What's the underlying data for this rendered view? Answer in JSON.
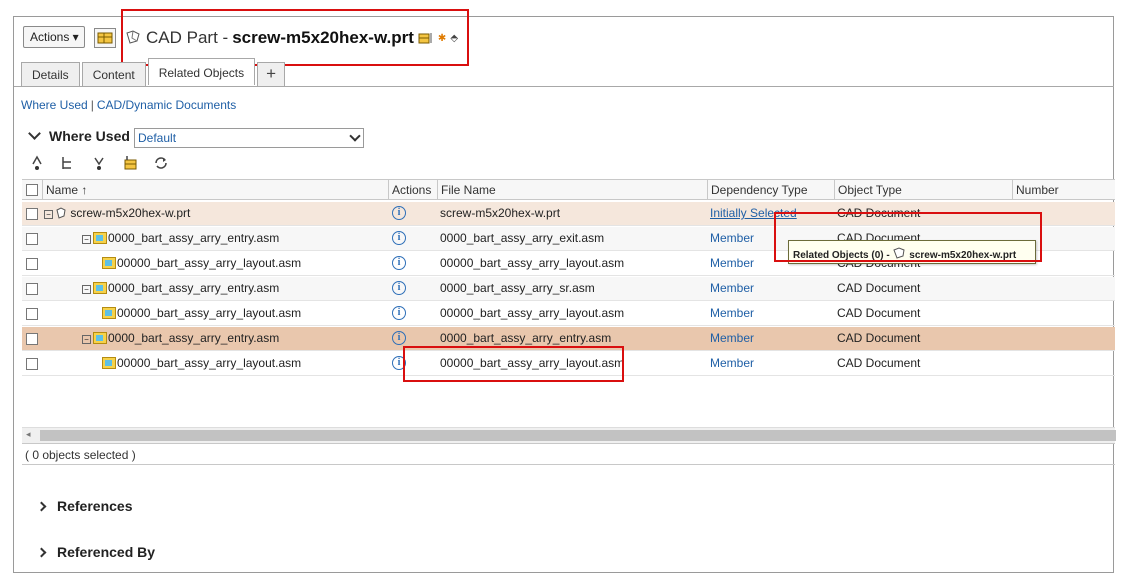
{
  "header": {
    "actions_label": "Actions ▾",
    "object_type": "CAD Part -",
    "object_name": "screw-m5x20hex-w.prt"
  },
  "tabs": [
    {
      "label": "Details"
    },
    {
      "label": "Content"
    },
    {
      "label": "Related Objects"
    },
    {
      "label": "+"
    }
  ],
  "links": {
    "where_used": "Where Used",
    "cad_docs": "CAD/Dynamic Documents"
  },
  "where_used": {
    "title": "Where Used",
    "view_value": "Default"
  },
  "columns": {
    "name": "Name ↑",
    "actions": "Actions",
    "file_name": "File Name",
    "dependency_type": "Dependency Type",
    "object_type": "Object Type",
    "number": "Number"
  },
  "rows": [
    {
      "name": "screw-m5x20hex-w.prt",
      "file": "screw-m5x20hex-w.prt",
      "dependency": "Initially Selected",
      "otype": "CAD Document"
    },
    {
      "name": "0000_bart_assy_arry_entry.asm",
      "file": "0000_bart_assy_arry_exit.asm",
      "dependency": "Member",
      "otype": "CAD Document"
    },
    {
      "name": "00000_bart_assy_arry_layout.asm",
      "file": "00000_bart_assy_arry_layout.asm",
      "dependency": "Member",
      "otype": "CAD Document"
    },
    {
      "name": "0000_bart_assy_arry_entry.asm",
      "file": "0000_bart_assy_arry_sr.asm",
      "dependency": "Member",
      "otype": "CAD Document"
    },
    {
      "name": "00000_bart_assy_arry_layout.asm",
      "file": "00000_bart_assy_arry_layout.asm",
      "dependency": "Member",
      "otype": "CAD Document"
    },
    {
      "name": "0000_bart_assy_arry_entry.asm",
      "file": "0000_bart_assy_arry_entry.asm",
      "dependency": "Member",
      "otype": "CAD Document"
    },
    {
      "name": "00000_bart_assy_arry_layout.asm",
      "file": "00000_bart_assy_arry_layout.asm",
      "dependency": "Member",
      "otype": "CAD Document"
    }
  ],
  "tooltip": {
    "prefix": "Related Objects (0) -",
    "name": "screw-m5x20hex-w.prt"
  },
  "selection": {
    "status": "( 0 objects selected )"
  },
  "sections": {
    "references": "References",
    "referenced_by": "Referenced By"
  },
  "colors": {
    "link": "#1f5fa6",
    "highlight_row": "#f5e7dc",
    "selected_row": "#e9c7ad",
    "red_outline": "#d90f0f"
  },
  "icons": [
    "menu-icon",
    "cad-part-icon",
    "tree-minus-icon",
    "assembly-icon",
    "info-icon",
    "refresh-icon"
  ]
}
